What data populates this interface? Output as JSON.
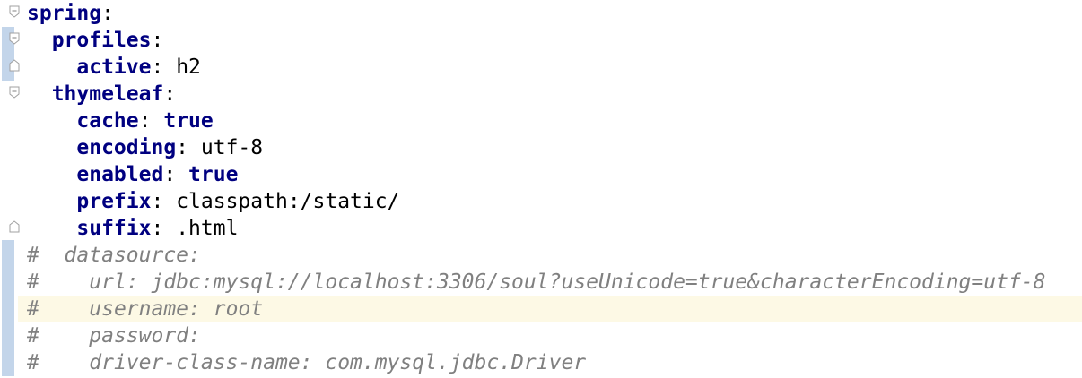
{
  "lines": [
    {
      "indent": "",
      "key": "spring",
      "colon": ":",
      "value": "",
      "kind": "key"
    },
    {
      "indent": "  ",
      "key": "profiles",
      "colon": ":",
      "value": "",
      "kind": "key"
    },
    {
      "indent": "    ",
      "key": "active",
      "colon": ":",
      "value": " h2",
      "kind": "key"
    },
    {
      "indent": "  ",
      "key": "thymeleaf",
      "colon": ":",
      "value": "",
      "kind": "key"
    },
    {
      "indent": "    ",
      "key": "cache",
      "colon": ":",
      "value": " true",
      "kind": "bool"
    },
    {
      "indent": "    ",
      "key": "encoding",
      "colon": ":",
      "value": " utf-8",
      "kind": "key"
    },
    {
      "indent": "    ",
      "key": "enabled",
      "colon": ":",
      "value": " true",
      "kind": "bool"
    },
    {
      "indent": "    ",
      "key": "prefix",
      "colon": ":",
      "value": " classpath:/static/",
      "kind": "key"
    },
    {
      "indent": "    ",
      "key": "suffix",
      "colon": ":",
      "value": " .html",
      "kind": "key"
    },
    {
      "hash": "#",
      "comment": "  datasource:",
      "kind": "comment"
    },
    {
      "hash": "#",
      "comment": "    url: jdbc:mysql://localhost:3306/soul?useUnicode=true&characterEncoding=utf-8",
      "kind": "comment"
    },
    {
      "hash": "#",
      "comment": "    username: root",
      "kind": "comment",
      "current": true
    },
    {
      "hash": "#",
      "comment": "    password:",
      "kind": "comment"
    },
    {
      "hash": "#",
      "comment": "    driver-class-name: com.mysql.jdbc.Driver",
      "kind": "comment"
    }
  ],
  "colors": {
    "key": "#000080",
    "comment": "#808080",
    "current_line": "#fdf9e5",
    "vcs_marker": "#c3d5ea"
  }
}
